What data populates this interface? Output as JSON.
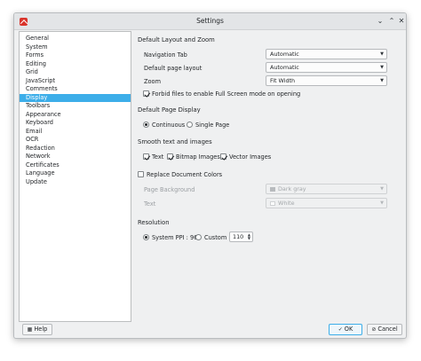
{
  "window": {
    "title": "Settings"
  },
  "sidebar": {
    "items": [
      {
        "label": "General"
      },
      {
        "label": "System"
      },
      {
        "label": "Forms"
      },
      {
        "label": "Editing"
      },
      {
        "label": "Grid"
      },
      {
        "label": "JavaScript"
      },
      {
        "label": "Comments"
      },
      {
        "label": "Display"
      },
      {
        "label": "Toolbars"
      },
      {
        "label": "Appearance"
      },
      {
        "label": "Keyboard"
      },
      {
        "label": "Email"
      },
      {
        "label": "OCR"
      },
      {
        "label": "Redaction"
      },
      {
        "label": "Network"
      },
      {
        "label": "Certificates"
      },
      {
        "label": "Language"
      },
      {
        "label": "Update"
      }
    ],
    "selected": "Display"
  },
  "layout": {
    "title": "Default Layout and Zoom",
    "navigation_tab_label": "Navigation Tab",
    "navigation_tab_value": "Automatic",
    "page_layout_label": "Default page layout",
    "page_layout_value": "Automatic",
    "zoom_label": "Zoom",
    "zoom_value": "Fit Width",
    "forbid_fullscreen_label": "Forbid files to enable Full Screen mode on opening",
    "forbid_fullscreen_checked": true
  },
  "page_display": {
    "title": "Default Page Display",
    "continuous_label": "Continuous",
    "single_page_label": "Single Page",
    "selected": "Continuous"
  },
  "smooth": {
    "title": "Smooth text and images",
    "text_label": "Text",
    "bitmap_label": "Bitmap Images",
    "vector_label": "Vector Images"
  },
  "colors": {
    "replace_label": "Replace Document Colors",
    "replace_checked": false,
    "page_background_label": "Page Background",
    "page_background_value": "Dark gray",
    "text_label": "Text",
    "text_value": "White"
  },
  "resolution": {
    "title": "Resolution",
    "system_ppi_label": "System PPI : 96",
    "custom_label": "Custom",
    "custom_value": "110",
    "selected": "System PPI"
  },
  "footer": {
    "help_label": "Help",
    "ok_label": "OK",
    "cancel_label": "Cancel"
  },
  "theme": {
    "accent": "#3daee9",
    "window_bg": "#eff0f1",
    "titlebar_bg": "#e3e5e7"
  }
}
